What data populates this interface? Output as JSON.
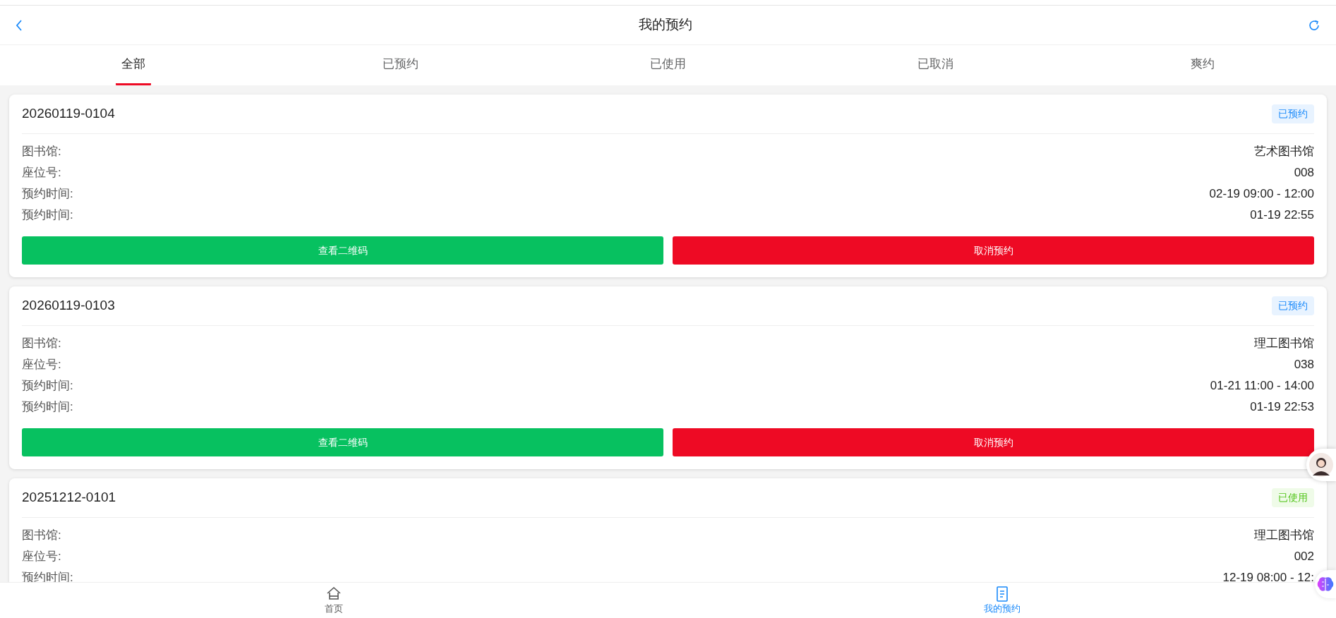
{
  "header": {
    "title": "我的预约"
  },
  "tabs": [
    {
      "label": "全部",
      "selected": true
    },
    {
      "label": "已预约",
      "selected": false
    },
    {
      "label": "已使用",
      "selected": false
    },
    {
      "label": "已取消",
      "selected": false
    },
    {
      "label": "爽约",
      "selected": false
    }
  ],
  "cards": [
    {
      "number": "20260119-0104",
      "status": {
        "label": "已预约",
        "kind": "reserved"
      },
      "rows": [
        {
          "label": "图书馆:",
          "value": "艺术图书馆"
        },
        {
          "label": "座位号:",
          "value": "008"
        },
        {
          "label": "预约时间:",
          "value": "02-19 09:00 - 12:00"
        },
        {
          "label": "预约时间:",
          "value": "01-19 22:55"
        }
      ],
      "buttons": [
        {
          "label": "查看二维码",
          "kind": "primary"
        },
        {
          "label": "取消预约",
          "kind": "danger"
        }
      ]
    },
    {
      "number": "20260119-0103",
      "status": {
        "label": "已预约",
        "kind": "reserved"
      },
      "rows": [
        {
          "label": "图书馆:",
          "value": "理工图书馆"
        },
        {
          "label": "座位号:",
          "value": "038"
        },
        {
          "label": "预约时间:",
          "value": "01-21 11:00 - 14:00"
        },
        {
          "label": "预约时间:",
          "value": "01-19 22:53"
        }
      ],
      "buttons": [
        {
          "label": "查看二维码",
          "kind": "primary"
        },
        {
          "label": "取消预约",
          "kind": "danger"
        }
      ]
    },
    {
      "number": "20251212-0101",
      "status": {
        "label": "已使用",
        "kind": "used"
      },
      "rows": [
        {
          "label": "图书馆:",
          "value": "理工图书馆"
        },
        {
          "label": "座位号:",
          "value": "002"
        },
        {
          "label": "预约时间:",
          "value": "12-19 08:00 - 12:"
        }
      ]
    }
  ],
  "bottom_nav": [
    {
      "label": "首页",
      "kind": "home",
      "selected": false
    },
    {
      "label": "我的预约",
      "kind": "document",
      "selected": true
    }
  ]
}
